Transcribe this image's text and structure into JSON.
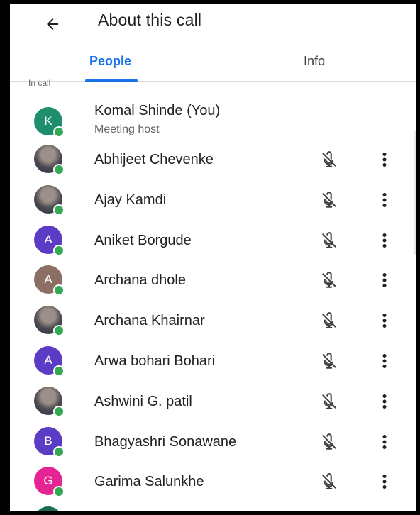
{
  "header": {
    "title": "About this call",
    "back_icon": "arrow-left-icon"
  },
  "tabs": [
    {
      "label": "People",
      "selected": true
    },
    {
      "label": "Info",
      "selected": false
    }
  ],
  "section_label": "In call",
  "host": {
    "name": "Komal Shinde (You)",
    "role": "Meeting host",
    "initial": "K",
    "color": "#1e8e6e"
  },
  "participants": [
    {
      "name": "Abhijeet Chevenke",
      "initial": "",
      "color": "#3a3f52",
      "photo": true
    },
    {
      "name": "Ajay Kamdi",
      "initial": "",
      "color": "#8b8b8b",
      "photo": true
    },
    {
      "name": "Aniket Borgude",
      "initial": "A",
      "color": "#5b3cc4"
    },
    {
      "name": "Archana dhole",
      "initial": "A",
      "color": "#8d6e63"
    },
    {
      "name": "Archana Khairnar",
      "initial": "",
      "color": "#6b4a3c",
      "photo": true
    },
    {
      "name": "Arwa bohari Bohari",
      "initial": "A",
      "color": "#5b3cc4"
    },
    {
      "name": "Ashwini G. patil",
      "initial": "",
      "color": "#9aa0a6",
      "photo": true
    },
    {
      "name": "Bhagyashri Sonawane",
      "initial": "B",
      "color": "#5b3cc4"
    },
    {
      "name": "Garima Salunkhe",
      "initial": "G",
      "color": "#e52592"
    }
  ],
  "icons": {
    "mic": "mic-off-icon",
    "more": "more-vert-icon"
  },
  "colors": {
    "accent": "#1a73e8",
    "online": "#34a853"
  }
}
